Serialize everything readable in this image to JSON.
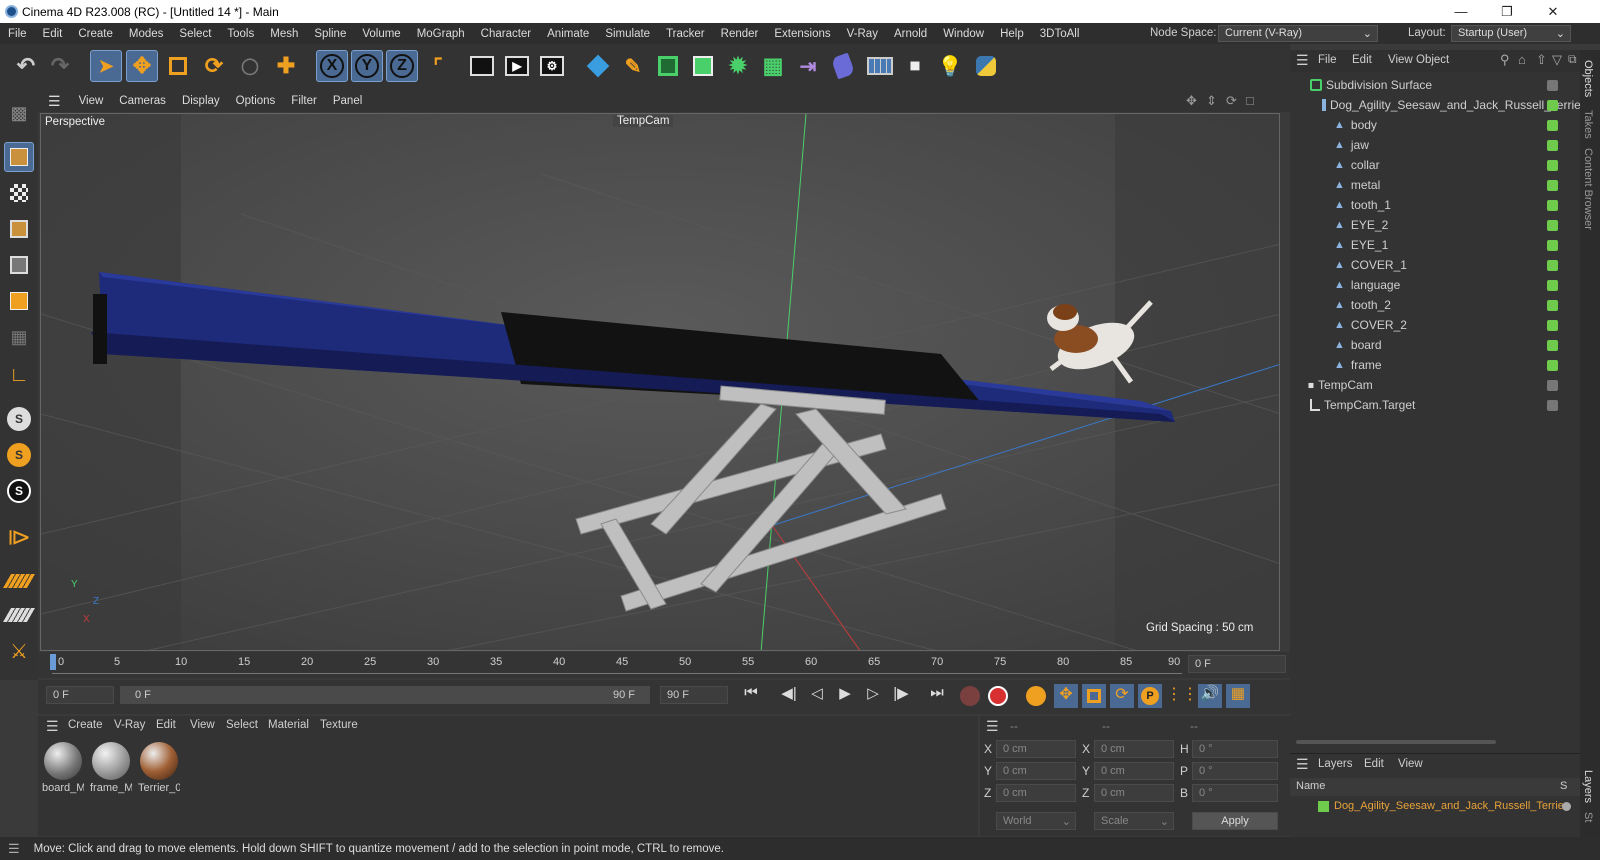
{
  "window": {
    "title": "Cinema 4D R23.008 (RC) - [Untitled 14 *] - Main"
  },
  "menu": [
    "File",
    "Edit",
    "Create",
    "Modes",
    "Select",
    "Tools",
    "Mesh",
    "Spline",
    "Volume",
    "MoGraph",
    "Character",
    "Animate",
    "Simulate",
    "Tracker",
    "Render",
    "Extensions",
    "V-Ray",
    "Arnold",
    "Window",
    "Help",
    "3DToAll"
  ],
  "node_space": {
    "label": "Node Space:",
    "value": "Current (V-Ray)"
  },
  "layout": {
    "label": "Layout:",
    "value": "Startup (User)"
  },
  "viewport": {
    "menu": [
      "View",
      "Cameras",
      "Display",
      "Options",
      "Filter",
      "Panel"
    ],
    "label": "Perspective",
    "camera": "TempCam",
    "grid_spacing": "Grid Spacing : 50 cm",
    "axis": {
      "y": "Y",
      "z": "Z",
      "x": "X"
    }
  },
  "timeline": {
    "ticks": [
      "0",
      "5",
      "10",
      "15",
      "20",
      "25",
      "30",
      "35",
      "40",
      "45",
      "50",
      "55",
      "60",
      "65",
      "70",
      "75",
      "80",
      "85",
      "90"
    ],
    "current_frame": "0 F"
  },
  "playback": {
    "start": "0 F",
    "range_start": "0 F",
    "range_end": "90 F",
    "end": "90 F"
  },
  "material_manager": {
    "menu": [
      "Create",
      "V-Ray",
      "Edit",
      "View",
      "Select",
      "Material",
      "Texture"
    ],
    "materials": [
      "board_M",
      "frame_M",
      "Terrier_0"
    ]
  },
  "coordinates": {
    "header": [
      "--",
      "--",
      "--"
    ],
    "rows": [
      {
        "a": "X",
        "av": "0 cm",
        "b": "X",
        "bv": "0 cm",
        "c": "H",
        "cv": "0 °"
      },
      {
        "a": "Y",
        "av": "0 cm",
        "b": "Y",
        "bv": "0 cm",
        "c": "P",
        "cv": "0 °"
      },
      {
        "a": "Z",
        "av": "0 cm",
        "b": "Z",
        "bv": "0 cm",
        "c": "B",
        "cv": "0 °"
      }
    ],
    "mode": "World",
    "scale": "Scale",
    "apply": "Apply"
  },
  "objects_panel": {
    "menu": [
      "File",
      "Edit",
      "View",
      "Object"
    ],
    "items": [
      {
        "label": "Subdivision Surface",
        "indent": 0
      },
      {
        "label": "Dog_Agility_Seesaw_and_Jack_Russell_Terrier",
        "indent": 1
      },
      {
        "label": "body",
        "indent": 2
      },
      {
        "label": "jaw",
        "indent": 2
      },
      {
        "label": "collar",
        "indent": 2
      },
      {
        "label": "metal",
        "indent": 2
      },
      {
        "label": "tooth_1",
        "indent": 2
      },
      {
        "label": "EYE_2",
        "indent": 2
      },
      {
        "label": "EYE_1",
        "indent": 2
      },
      {
        "label": "COVER_1",
        "indent": 2
      },
      {
        "label": "language",
        "indent": 2
      },
      {
        "label": "tooth_2",
        "indent": 2
      },
      {
        "label": "COVER_2",
        "indent": 2
      },
      {
        "label": "board",
        "indent": 2
      },
      {
        "label": "frame",
        "indent": 2
      },
      {
        "label": "TempCam",
        "indent": 0
      },
      {
        "label": "TempCam.Target",
        "indent": 0
      }
    ]
  },
  "layers_panel": {
    "menu": [
      "Layers",
      "Edit",
      "View"
    ],
    "columns": [
      "Name",
      "S"
    ],
    "items": [
      "Dog_Agility_Seesaw_and_Jack_Russell_Terrier"
    ]
  },
  "side_tabs": [
    "Objects",
    "Takes",
    "Content Browser",
    "Layers",
    "St"
  ],
  "status": "Move: Click and drag to move elements. Hold down SHIFT to quantize movement / add to the selection in point mode, CTRL to remove.",
  "colors": {
    "accent": "#4a6a93",
    "layer": "#e8a23a",
    "check": "#6fcb4b"
  }
}
